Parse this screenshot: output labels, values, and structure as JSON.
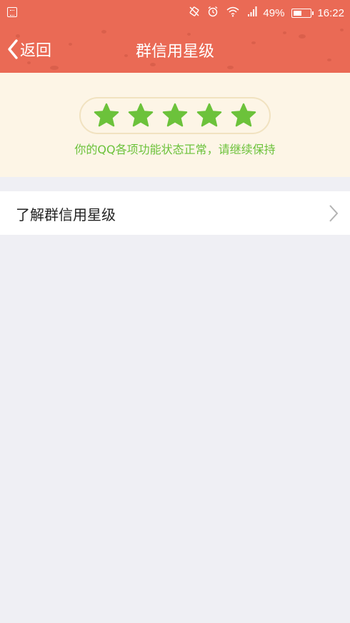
{
  "status_bar": {
    "battery_percent_text": "49%",
    "battery_level": 0.49,
    "time": "16:22",
    "icons": [
      "screenshot-icon",
      "vibrate-icon",
      "alarm-icon",
      "wifi-icon",
      "signal-icon",
      "battery-icon"
    ]
  },
  "navbar": {
    "back_label": "返回",
    "title": "群信用星级"
  },
  "rating": {
    "stars": 5,
    "max_stars": 5,
    "message": "你的QQ各项功能状态正常，请继续保持"
  },
  "info_row": {
    "label": "了解群信用星级"
  },
  "colors": {
    "header": "#ea6a55",
    "panel_bg": "#fdf5e6",
    "star": "#6cc23b",
    "page_bg": "#efeff4"
  }
}
